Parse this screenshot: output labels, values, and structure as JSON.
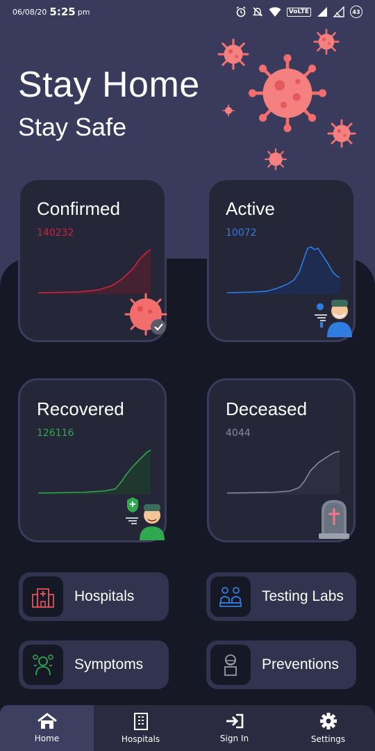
{
  "status_bar": {
    "date": "06/08/20",
    "time": "5:25",
    "ampm": "pm",
    "network_label": "VoLTE",
    "battery": "43"
  },
  "header": {
    "title": "Stay Home",
    "subtitle": "Stay Safe"
  },
  "stats": {
    "confirmed": {
      "label": "Confirmed",
      "value": "140232",
      "color": "#d0243e"
    },
    "active": {
      "label": "Active",
      "value": "10072",
      "color": "#2f7de0"
    },
    "recovered": {
      "label": "Recovered",
      "value": "126116",
      "color": "#2fa84f"
    },
    "deceased": {
      "label": "Deceased",
      "value": "4044",
      "color": "#8a8a9a"
    }
  },
  "menu": {
    "hospitals": {
      "label": "Hospitals",
      "icon": "hospital-icon"
    },
    "testing_labs": {
      "label": "Testing Labs",
      "icon": "lab-icon"
    },
    "symptoms": {
      "label": "Symptoms",
      "icon": "symptoms-icon"
    },
    "preventions": {
      "label": "Preventions",
      "icon": "mask-person-icon"
    }
  },
  "bottom_nav": {
    "home": {
      "label": "Home",
      "icon": "home-icon"
    },
    "hospitals": {
      "label": "Hospitals",
      "icon": "building-icon"
    },
    "sign_in": {
      "label": "Sign In",
      "icon": "sign-in-icon"
    },
    "settings": {
      "label": "Settings",
      "icon": "gear-icon"
    }
  },
  "colors": {
    "hero_bg": "#3a3b5c",
    "page_bg": "#171826",
    "card_bg": "#262639",
    "virus": "#f26d6d"
  }
}
